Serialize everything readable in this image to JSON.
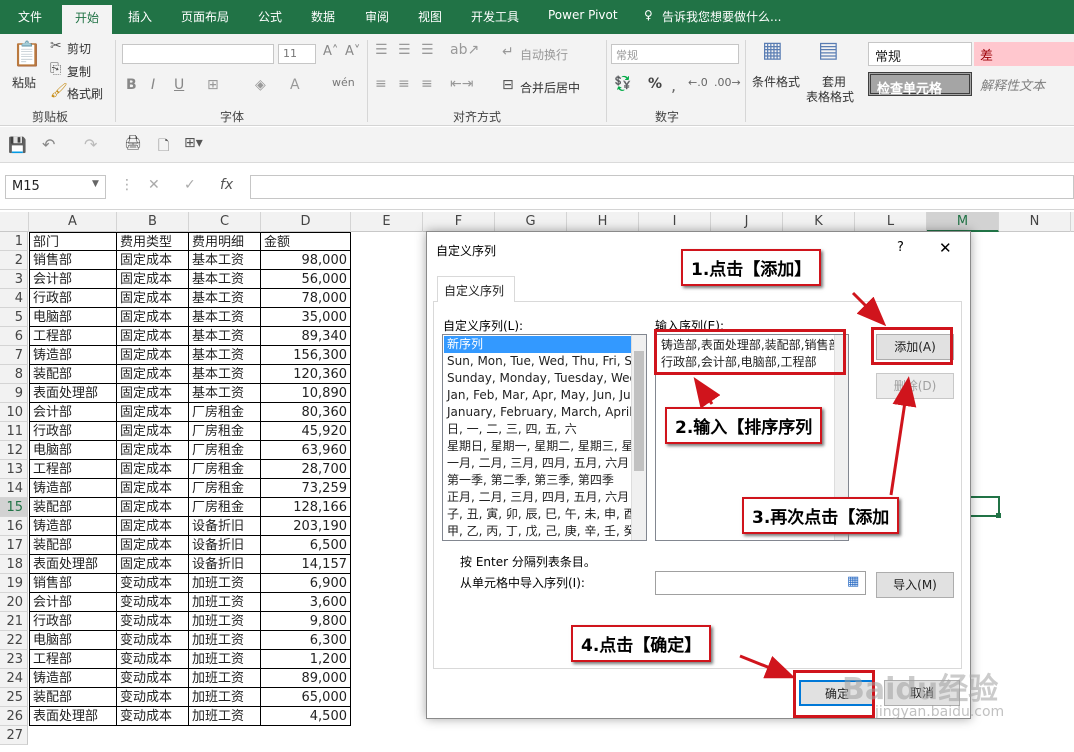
{
  "ribbon_tabs": [
    "文件",
    "开始",
    "插入",
    "页面布局",
    "公式",
    "数据",
    "审阅",
    "视图",
    "开发工具",
    "Power Pivot"
  ],
  "tell_me": "告诉我您想要做什么...",
  "clipboard": {
    "paste": "粘贴",
    "cut": "剪切",
    "copy": "复制",
    "format_painter": "格式刷",
    "label": "剪贴板"
  },
  "font": {
    "size": "11",
    "label": "字体",
    "bold": "B",
    "italic": "I",
    "underline": "U"
  },
  "alignment": {
    "wrap": "自动换行",
    "merge": "合并后居中",
    "label": "对齐方式"
  },
  "number": {
    "format": "常规",
    "label": "数字",
    "percent": "%"
  },
  "styles": {
    "cond_format_1": "条件格式",
    "cond_format_2": "",
    "table_fmt_1": "套用",
    "table_fmt_2": "表格格式",
    "normal": "常规",
    "bad": "差",
    "check_cell": "检查单元格",
    "explanatory": "解释性文本"
  },
  "name_box": "M15",
  "fx": "fx",
  "colors": {
    "excel_green": "#217346",
    "annotation_red": "#d0141c",
    "selected_blue": "#3399ff"
  },
  "columns": [
    "A",
    "B",
    "C",
    "D",
    "E",
    "F",
    "G",
    "H",
    "I",
    "J",
    "K",
    "L",
    "M",
    "N"
  ],
  "rows": [
    [
      "1",
      "部门",
      "费用类型",
      "费用明细",
      "金额"
    ],
    [
      "2",
      "销售部",
      "固定成本",
      "基本工资",
      "98,000"
    ],
    [
      "3",
      "会计部",
      "固定成本",
      "基本工资",
      "56,000"
    ],
    [
      "4",
      "行政部",
      "固定成本",
      "基本工资",
      "78,000"
    ],
    [
      "5",
      "电脑部",
      "固定成本",
      "基本工资",
      "35,000"
    ],
    [
      "6",
      "工程部",
      "固定成本",
      "基本工资",
      "89,340"
    ],
    [
      "7",
      "铸造部",
      "固定成本",
      "基本工资",
      "156,300"
    ],
    [
      "8",
      "装配部",
      "固定成本",
      "基本工资",
      "120,360"
    ],
    [
      "9",
      "表面处理部",
      "固定成本",
      "基本工资",
      "10,890"
    ],
    [
      "10",
      "会计部",
      "固定成本",
      "厂房租金",
      "80,360"
    ],
    [
      "11",
      "行政部",
      "固定成本",
      "厂房租金",
      "45,920"
    ],
    [
      "12",
      "电脑部",
      "固定成本",
      "厂房租金",
      "63,960"
    ],
    [
      "13",
      "工程部",
      "固定成本",
      "厂房租金",
      "28,700"
    ],
    [
      "14",
      "铸造部",
      "固定成本",
      "厂房租金",
      "73,259"
    ],
    [
      "15",
      "装配部",
      "固定成本",
      "厂房租金",
      "128,166"
    ],
    [
      "16",
      "铸造部",
      "固定成本",
      "设备折旧",
      "203,190"
    ],
    [
      "17",
      "装配部",
      "固定成本",
      "设备折旧",
      "6,500"
    ],
    [
      "18",
      "表面处理部",
      "固定成本",
      "设备折旧",
      "14,157"
    ],
    [
      "19",
      "销售部",
      "变动成本",
      "加班工资",
      "6,900"
    ],
    [
      "20",
      "会计部",
      "变动成本",
      "加班工资",
      "3,600"
    ],
    [
      "21",
      "行政部",
      "变动成本",
      "加班工资",
      "9,800"
    ],
    [
      "22",
      "电脑部",
      "变动成本",
      "加班工资",
      "6,300"
    ],
    [
      "23",
      "工程部",
      "变动成本",
      "加班工资",
      "1,200"
    ],
    [
      "24",
      "铸造部",
      "变动成本",
      "加班工资",
      "89,000"
    ],
    [
      "25",
      "装配部",
      "变动成本",
      "加班工资",
      "65,000"
    ],
    [
      "26",
      "表面处理部",
      "变动成本",
      "加班工资",
      "4,500"
    ],
    [
      "27",
      "",
      "",
      "",
      ""
    ]
  ],
  "dialog": {
    "title": "自定义序列",
    "help": "?",
    "close": "✕",
    "tab": "自定义序列",
    "list_label": "自定义序列(L):",
    "input_label": "输入序列(E):",
    "lists": [
      "新序列",
      "Sun, Mon, Tue, Wed, Thu, Fri, Sat",
      "Sunday, Monday, Tuesday, Wednesday",
      "Jan, Feb, Mar, Apr, May, Jun, Jul",
      "January, February, March, April",
      "日, 一, 二, 三, 四, 五, 六",
      "星期日, 星期一, 星期二, 星期三, 星期四",
      "一月, 二月, 三月, 四月, 五月, 六月",
      "第一季, 第二季, 第三季, 第四季",
      "正月, 二月, 三月, 四月, 五月, 六月",
      "子, 丑, 寅, 卯, 辰, 巳, 午, 未, 申, 酉",
      "甲, 乙, 丙, 丁, 戊, 己, 庚, 辛, 壬, 癸"
    ],
    "input_line1": "铸造部,表面处理部,装配部,销售部,",
    "input_line2": "行政部,会计部,电脑部,工程部",
    "add": "添加(A)",
    "delete": "删除(D)",
    "hint": "按 Enter 分隔列表条目。",
    "import_label": "从单元格中导入序列(I):",
    "import": "导入(M)",
    "ok": "确定",
    "cancel": "取消"
  },
  "annotations": [
    "1.点击【添加】",
    "2.输入【排序序列",
    "3.再次点击【添加",
    "4.点击【确定】"
  ],
  "watermark": {
    "brand": "Baidu经验",
    "url": "jingyan.baidu.com"
  }
}
